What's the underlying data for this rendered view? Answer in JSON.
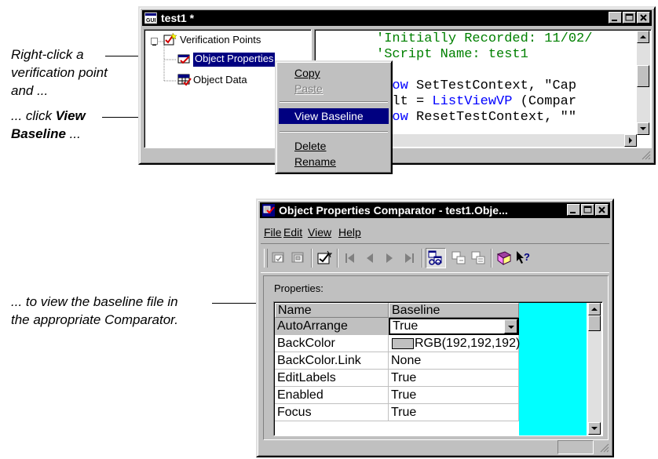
{
  "annotations": {
    "a1_line1": "Right-click a",
    "a1_line2": "verification point",
    "a1_line3": "and ...",
    "a2_prefix": "... click ",
    "a2_bold1": "View",
    "a2_bold2": "Baseline",
    "a2_suffix": " ...",
    "a3_line1": "... to view the baseline file in",
    "a3_line2": "the appropriate Comparator."
  },
  "script_window": {
    "title": "test1 *",
    "tree": {
      "root": "Verification Points",
      "item1": "Object Properties",
      "item2": "Object Data"
    },
    "code_lines": [
      {
        "prefix": "",
        "text": "'Initially Recorded: 11/02/"
      },
      {
        "prefix": "",
        "text": "'Script Name: test1"
      },
      {
        "prefix": "",
        "text": ""
      },
      {
        "prefix": "ndow",
        "text": " SetTestContext, \"Cap"
      },
      {
        "prefix": "sult = ",
        "fn": "ListViewVP",
        "text": " (Compar"
      },
      {
        "prefix": "ndow",
        "text": " ResetTestContext, \"\""
      }
    ]
  },
  "context_menu": {
    "copy": "Copy",
    "paste": "Paste",
    "view_baseline": "View Baseline",
    "delete": "Delete",
    "rename": "Rename"
  },
  "comparator": {
    "title": "Object Properties Comparator - test1.Obje...",
    "menu": [
      "File",
      "Edit",
      "View",
      "Help"
    ],
    "properties_label": "Properties:",
    "columns": [
      "Name",
      "Baseline"
    ],
    "rows": [
      {
        "name": "AutoArrange",
        "value": "True"
      },
      {
        "name": "BackColor",
        "value": "RGB(192,192,192)"
      },
      {
        "name": "BackColor.Link",
        "value": "None"
      },
      {
        "name": "EditLabels",
        "value": "True"
      },
      {
        "name": "Enabled",
        "value": "True"
      },
      {
        "name": "Focus",
        "value": "True"
      }
    ],
    "accent_cyan": "#00ffff"
  },
  "colors": {
    "title_bar": "#000000",
    "selection": "#000080",
    "code_comment": "#008000",
    "code_function": "#0000ff"
  }
}
